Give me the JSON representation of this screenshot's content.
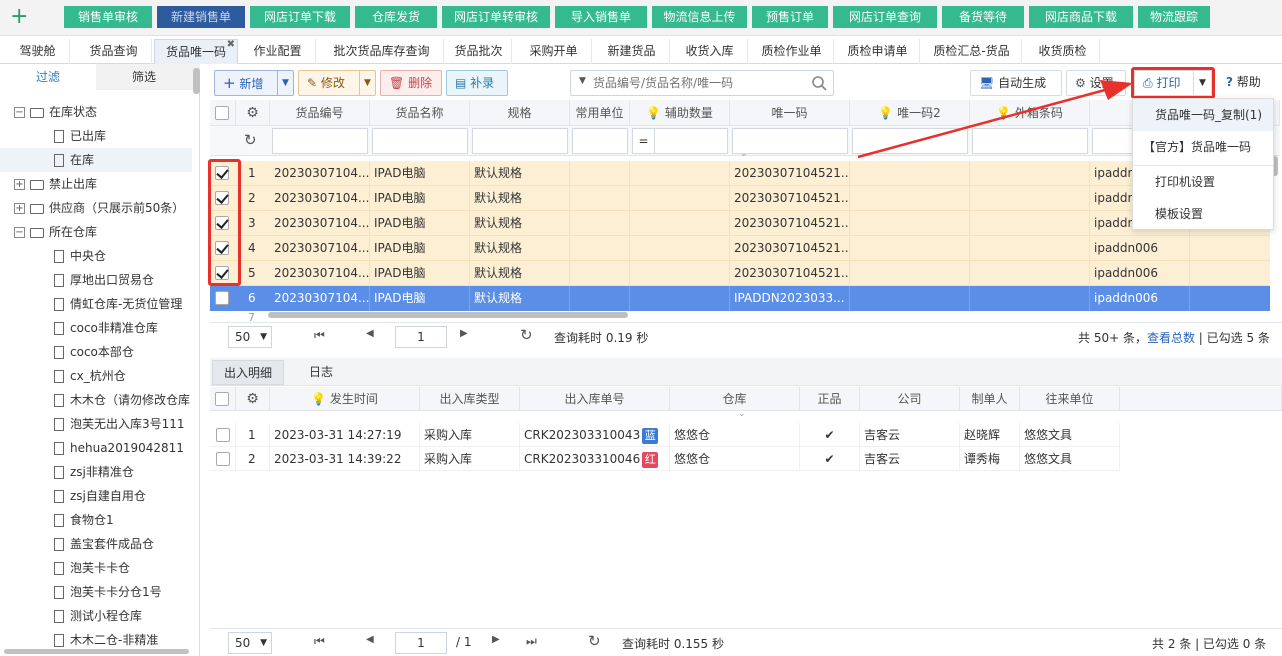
{
  "quick_buttons": [
    "销售单审核",
    "新建销售单",
    "网店订单下载",
    "仓库发货",
    "网店订单转审核",
    "导入销售单",
    "物流信息上传",
    "预售订单",
    "网店订单查询",
    "备货等待",
    "网店商品下载",
    "物流跟踪"
  ],
  "tabs": [
    "驾驶舱",
    "货品查询",
    "货品唯一码",
    "作业配置",
    "批次货品库存查询",
    "货品批次",
    "采购开单",
    "新建货品",
    "收货入库",
    "质检作业单",
    "质检申请单",
    "质检汇总-货品",
    "收货质检"
  ],
  "left": {
    "tabs": [
      "过滤",
      "筛选"
    ],
    "tree": [
      {
        "level": 0,
        "label": "在库状态",
        "expander": "⊟",
        "open": true
      },
      {
        "level": 1,
        "label": "已出库"
      },
      {
        "level": 1,
        "label": "在库",
        "selected": true
      },
      {
        "level": 0,
        "label": "禁止出库",
        "expander": "⊞"
      },
      {
        "level": 0,
        "label": "供应商（只展示前50条）",
        "expander": "⊞"
      },
      {
        "level": 0,
        "label": "所在仓库",
        "expander": "⊟",
        "open": true
      },
      {
        "level": 1,
        "label": "中央仓"
      },
      {
        "level": 1,
        "label": "厚地出口贸易仓"
      },
      {
        "level": 1,
        "label": "倩虹仓库-无货位管理"
      },
      {
        "level": 1,
        "label": "coco非精准仓库"
      },
      {
        "level": 1,
        "label": "coco本部仓"
      },
      {
        "level": 1,
        "label": "cx_杭州仓"
      },
      {
        "level": 1,
        "label": "木木仓（请勿修改仓库"
      },
      {
        "level": 1,
        "label": "泡芙无出入库3号111"
      },
      {
        "level": 1,
        "label": "hehua2019042811"
      },
      {
        "level": 1,
        "label": "zsj非精准仓"
      },
      {
        "level": 1,
        "label": "zsj自建自用仓"
      },
      {
        "level": 1,
        "label": "食物仓1"
      },
      {
        "level": 1,
        "label": "盖宝套件成品仓"
      },
      {
        "level": 1,
        "label": "泡芙卡卡仓"
      },
      {
        "level": 1,
        "label": "泡芙卡卡分仓1号"
      },
      {
        "level": 1,
        "label": "测试小程仓库"
      },
      {
        "level": 1,
        "label": "木木二仓-非精准"
      }
    ]
  },
  "toolbar": {
    "add": "新增",
    "edit": "修改",
    "delete": "删除",
    "replenish": "补录",
    "search_placeholder": "货品编号/货品名称/唯一码",
    "auto_generate": "自动生成",
    "settings": "设置",
    "print": "打印",
    "help": "帮助"
  },
  "print_menu": [
    "货品唯一码_复制(1)",
    "【官方】货品唯一码",
    "打印机设置",
    "模板设置"
  ],
  "grid": {
    "headers": [
      "货品编号",
      "货品名称",
      "规格",
      "常用单位",
      "辅助数量",
      "唯一码",
      "唯一码2",
      "外箱条码"
    ],
    "filter_eq": "=",
    "rows": [
      {
        "n": "1",
        "code": "20230307104...",
        "name": "IPAD电脑",
        "spec": "默认规格",
        "uid": "20230307104521...",
        "box": "ipaddn",
        "checked": true
      },
      {
        "n": "2",
        "code": "20230307104...",
        "name": "IPAD电脑",
        "spec": "默认规格",
        "uid": "20230307104521...",
        "box": "ipaddn",
        "checked": true
      },
      {
        "n": "3",
        "code": "20230307104...",
        "name": "IPAD电脑",
        "spec": "默认规格",
        "uid": "20230307104521...",
        "box": "ipaddn",
        "checked": true
      },
      {
        "n": "4",
        "code": "20230307104...",
        "name": "IPAD电脑",
        "spec": "默认规格",
        "uid": "20230307104521...",
        "box": "ipaddn006",
        "checked": true
      },
      {
        "n": "5",
        "code": "20230307104...",
        "name": "IPAD电脑",
        "spec": "默认规格",
        "uid": "20230307104521...",
        "box": "ipaddn006",
        "checked": true
      },
      {
        "n": "6",
        "code": "20230307104...",
        "name": "IPAD电脑",
        "spec": "默认规格",
        "uid": "IPADDN2023033...",
        "box": "ipaddn006",
        "checked": false
      }
    ],
    "next_row": "7"
  },
  "pager_top": {
    "page_size": "50",
    "page": "1",
    "time": "查询耗时 0.19 秒",
    "summary_a": "共 50+ 条，",
    "summary_link": "查看总数",
    "summary_b": " | 已勾选 5 条"
  },
  "bottom": {
    "tabs": [
      "出入明细",
      "日志"
    ],
    "headers": [
      "发生时间",
      "出入库类型",
      "出入库单号",
      "仓库",
      "正品",
      "公司",
      "制单人",
      "往来单位"
    ],
    "rows": [
      {
        "n": "1",
        "time": "2023-03-31 14:27:19",
        "type": "采购入库",
        "no": "CRK202303310043",
        "tag": "蓝",
        "tag_color": "#3a7bd5",
        "wh": "悠悠仓",
        "genuine": "✔",
        "company": "吉客云",
        "maker": "赵晓辉",
        "partner": "悠悠文具"
      },
      {
        "n": "2",
        "time": "2023-03-31 14:39:22",
        "type": "采购入库",
        "no": "CRK202303310046",
        "tag": "红",
        "tag_color": "#e6475c",
        "wh": "悠悠仓",
        "genuine": "✔",
        "company": "吉客云",
        "maker": "谭秀梅",
        "partner": "悠悠文具"
      }
    ]
  },
  "pager_bottom": {
    "page_size": "50",
    "page": "1",
    "pages": "/ 1",
    "time": "查询耗时 0.155 秒",
    "summary": "共 2 条 | 已勾选 0 条"
  },
  "colors": {
    "accent": "#35b98e",
    "selected_row": "#5b8ee6",
    "checked_row": "#fdefd4",
    "annotation": "#e8312a"
  }
}
